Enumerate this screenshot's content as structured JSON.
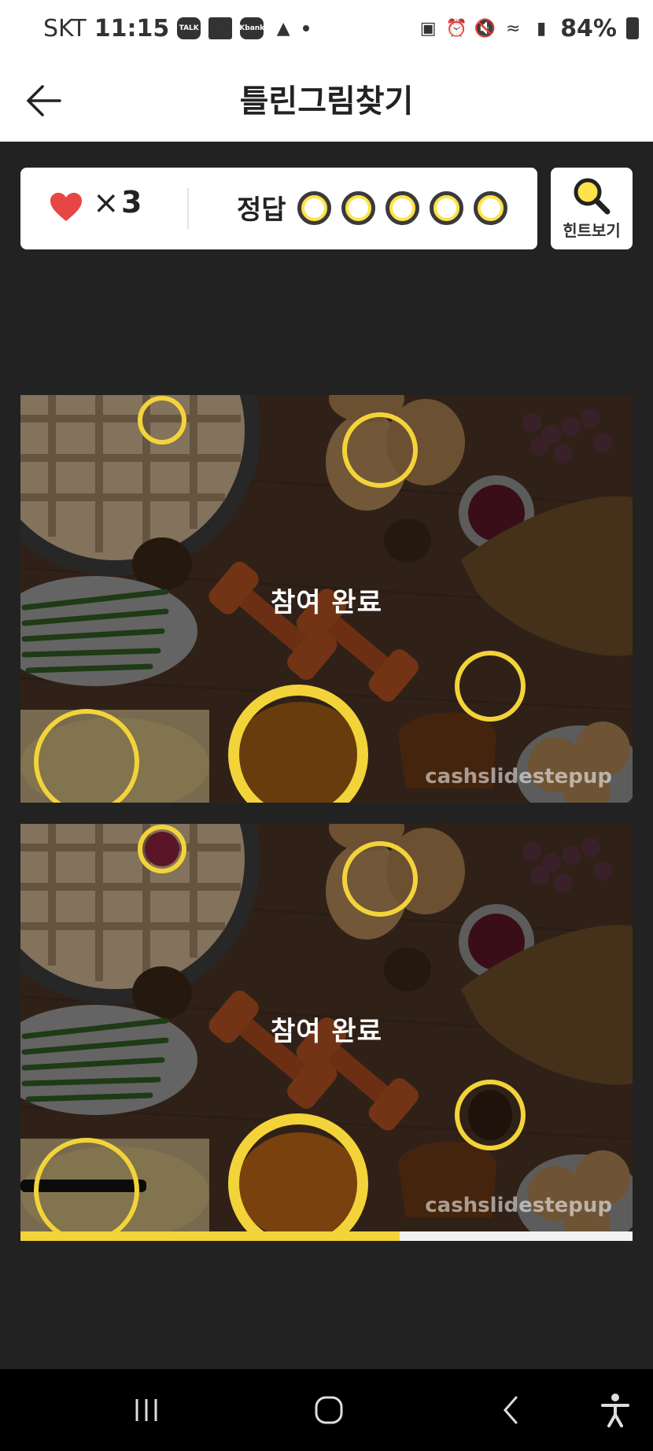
{
  "status_bar": {
    "carrier": "SKT",
    "time": "11:15",
    "battery": "84%",
    "app_icons": [
      "talk-icon",
      "notes-icon",
      "kbank-icon",
      "game-icon"
    ],
    "talk_label": "TALK",
    "kbank_label": "Kbank"
  },
  "header": {
    "title": "틀린그림찾기"
  },
  "score": {
    "times_symbol": "×",
    "lives": "3",
    "answer_label": "정답",
    "answers_found": 0,
    "answers_total": 5
  },
  "hint": {
    "label": "힌트보기"
  },
  "game": {
    "overlay_text": "참여 완료",
    "watermark": "cashslidestepup",
    "progress": 0.62
  },
  "colors": {
    "accent_yellow": "#f3d33a",
    "heart_red": "#e84545",
    "background": "#222222"
  }
}
